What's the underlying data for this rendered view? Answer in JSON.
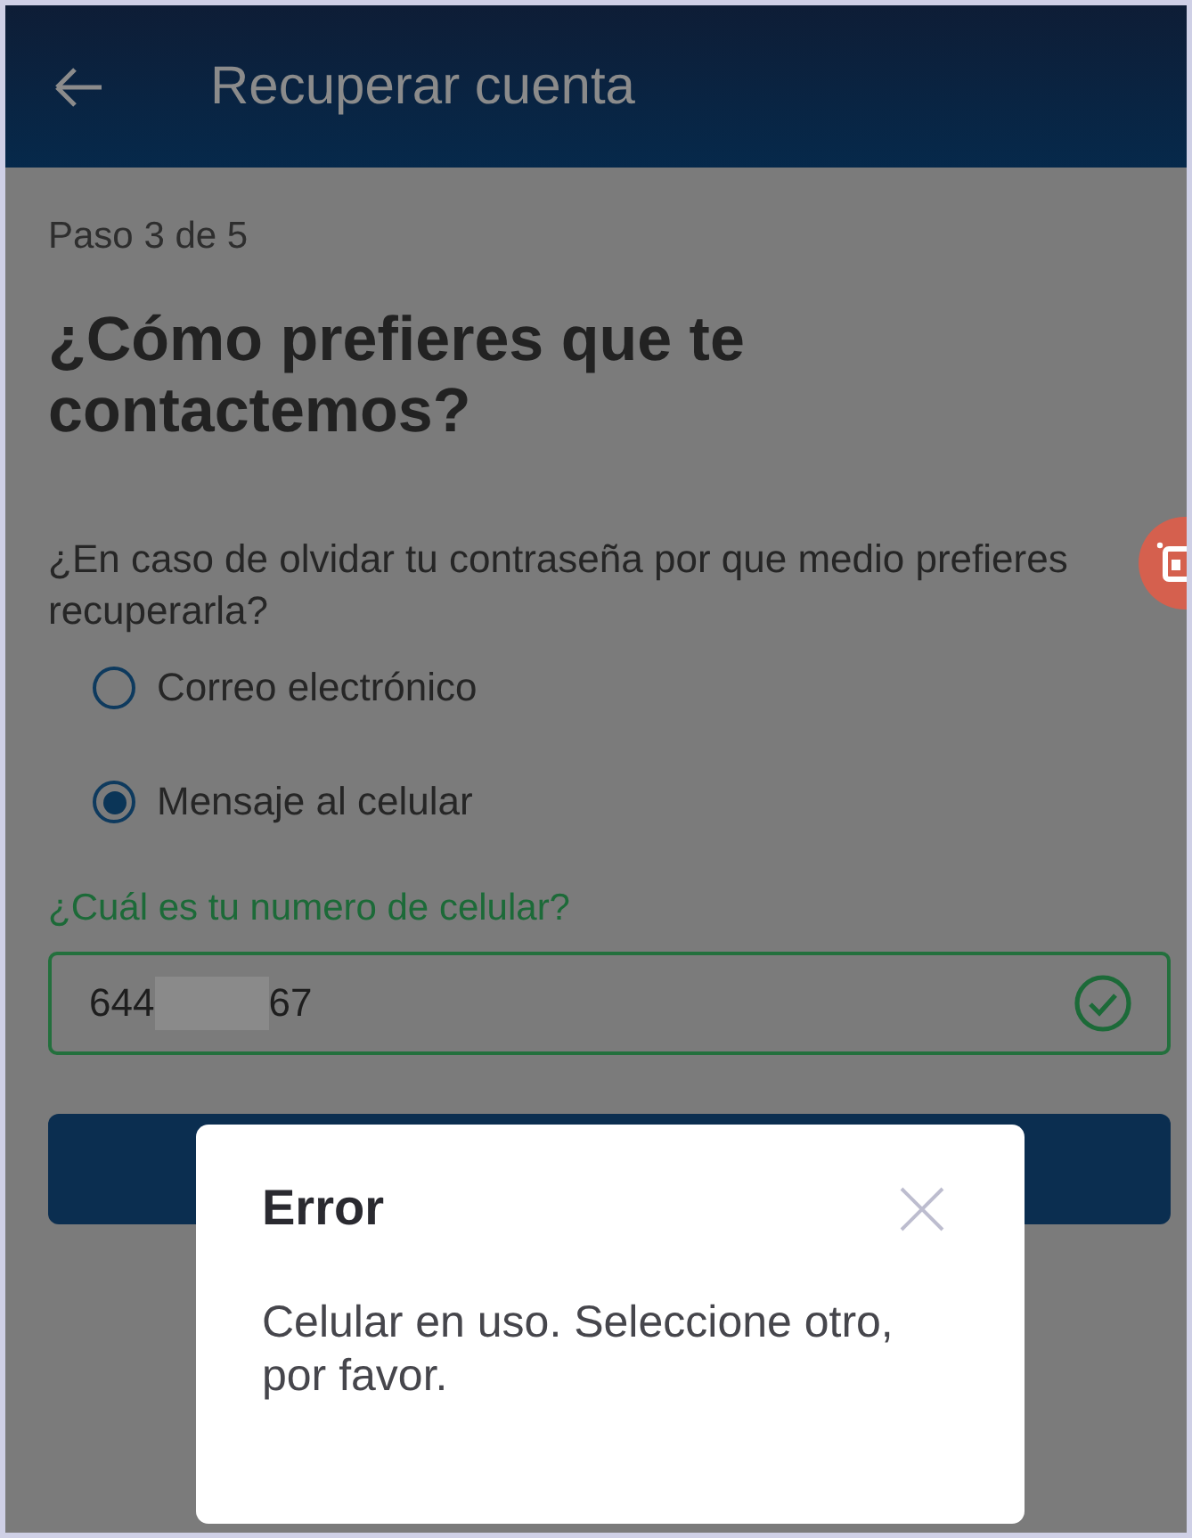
{
  "app_bar": {
    "title": "Recuperar cuenta"
  },
  "step": "Paso 3 de 5",
  "heading": "¿Cómo prefieres que te contactemos?",
  "question": "¿En caso de olvidar tu contraseña por que medio prefieres recuperarla?",
  "options": [
    {
      "label": "Correo electrónico",
      "selected": false
    },
    {
      "label": "Mensaje al celular",
      "selected": true
    }
  ],
  "phone_field": {
    "label": "¿Cuál es tu numero de celular?",
    "value_start": "644",
    "value_end": "67",
    "redacted": true,
    "valid": true
  },
  "dialog": {
    "title": "Error",
    "message": "Celular en uso. Seleccione otro, por favor."
  }
}
